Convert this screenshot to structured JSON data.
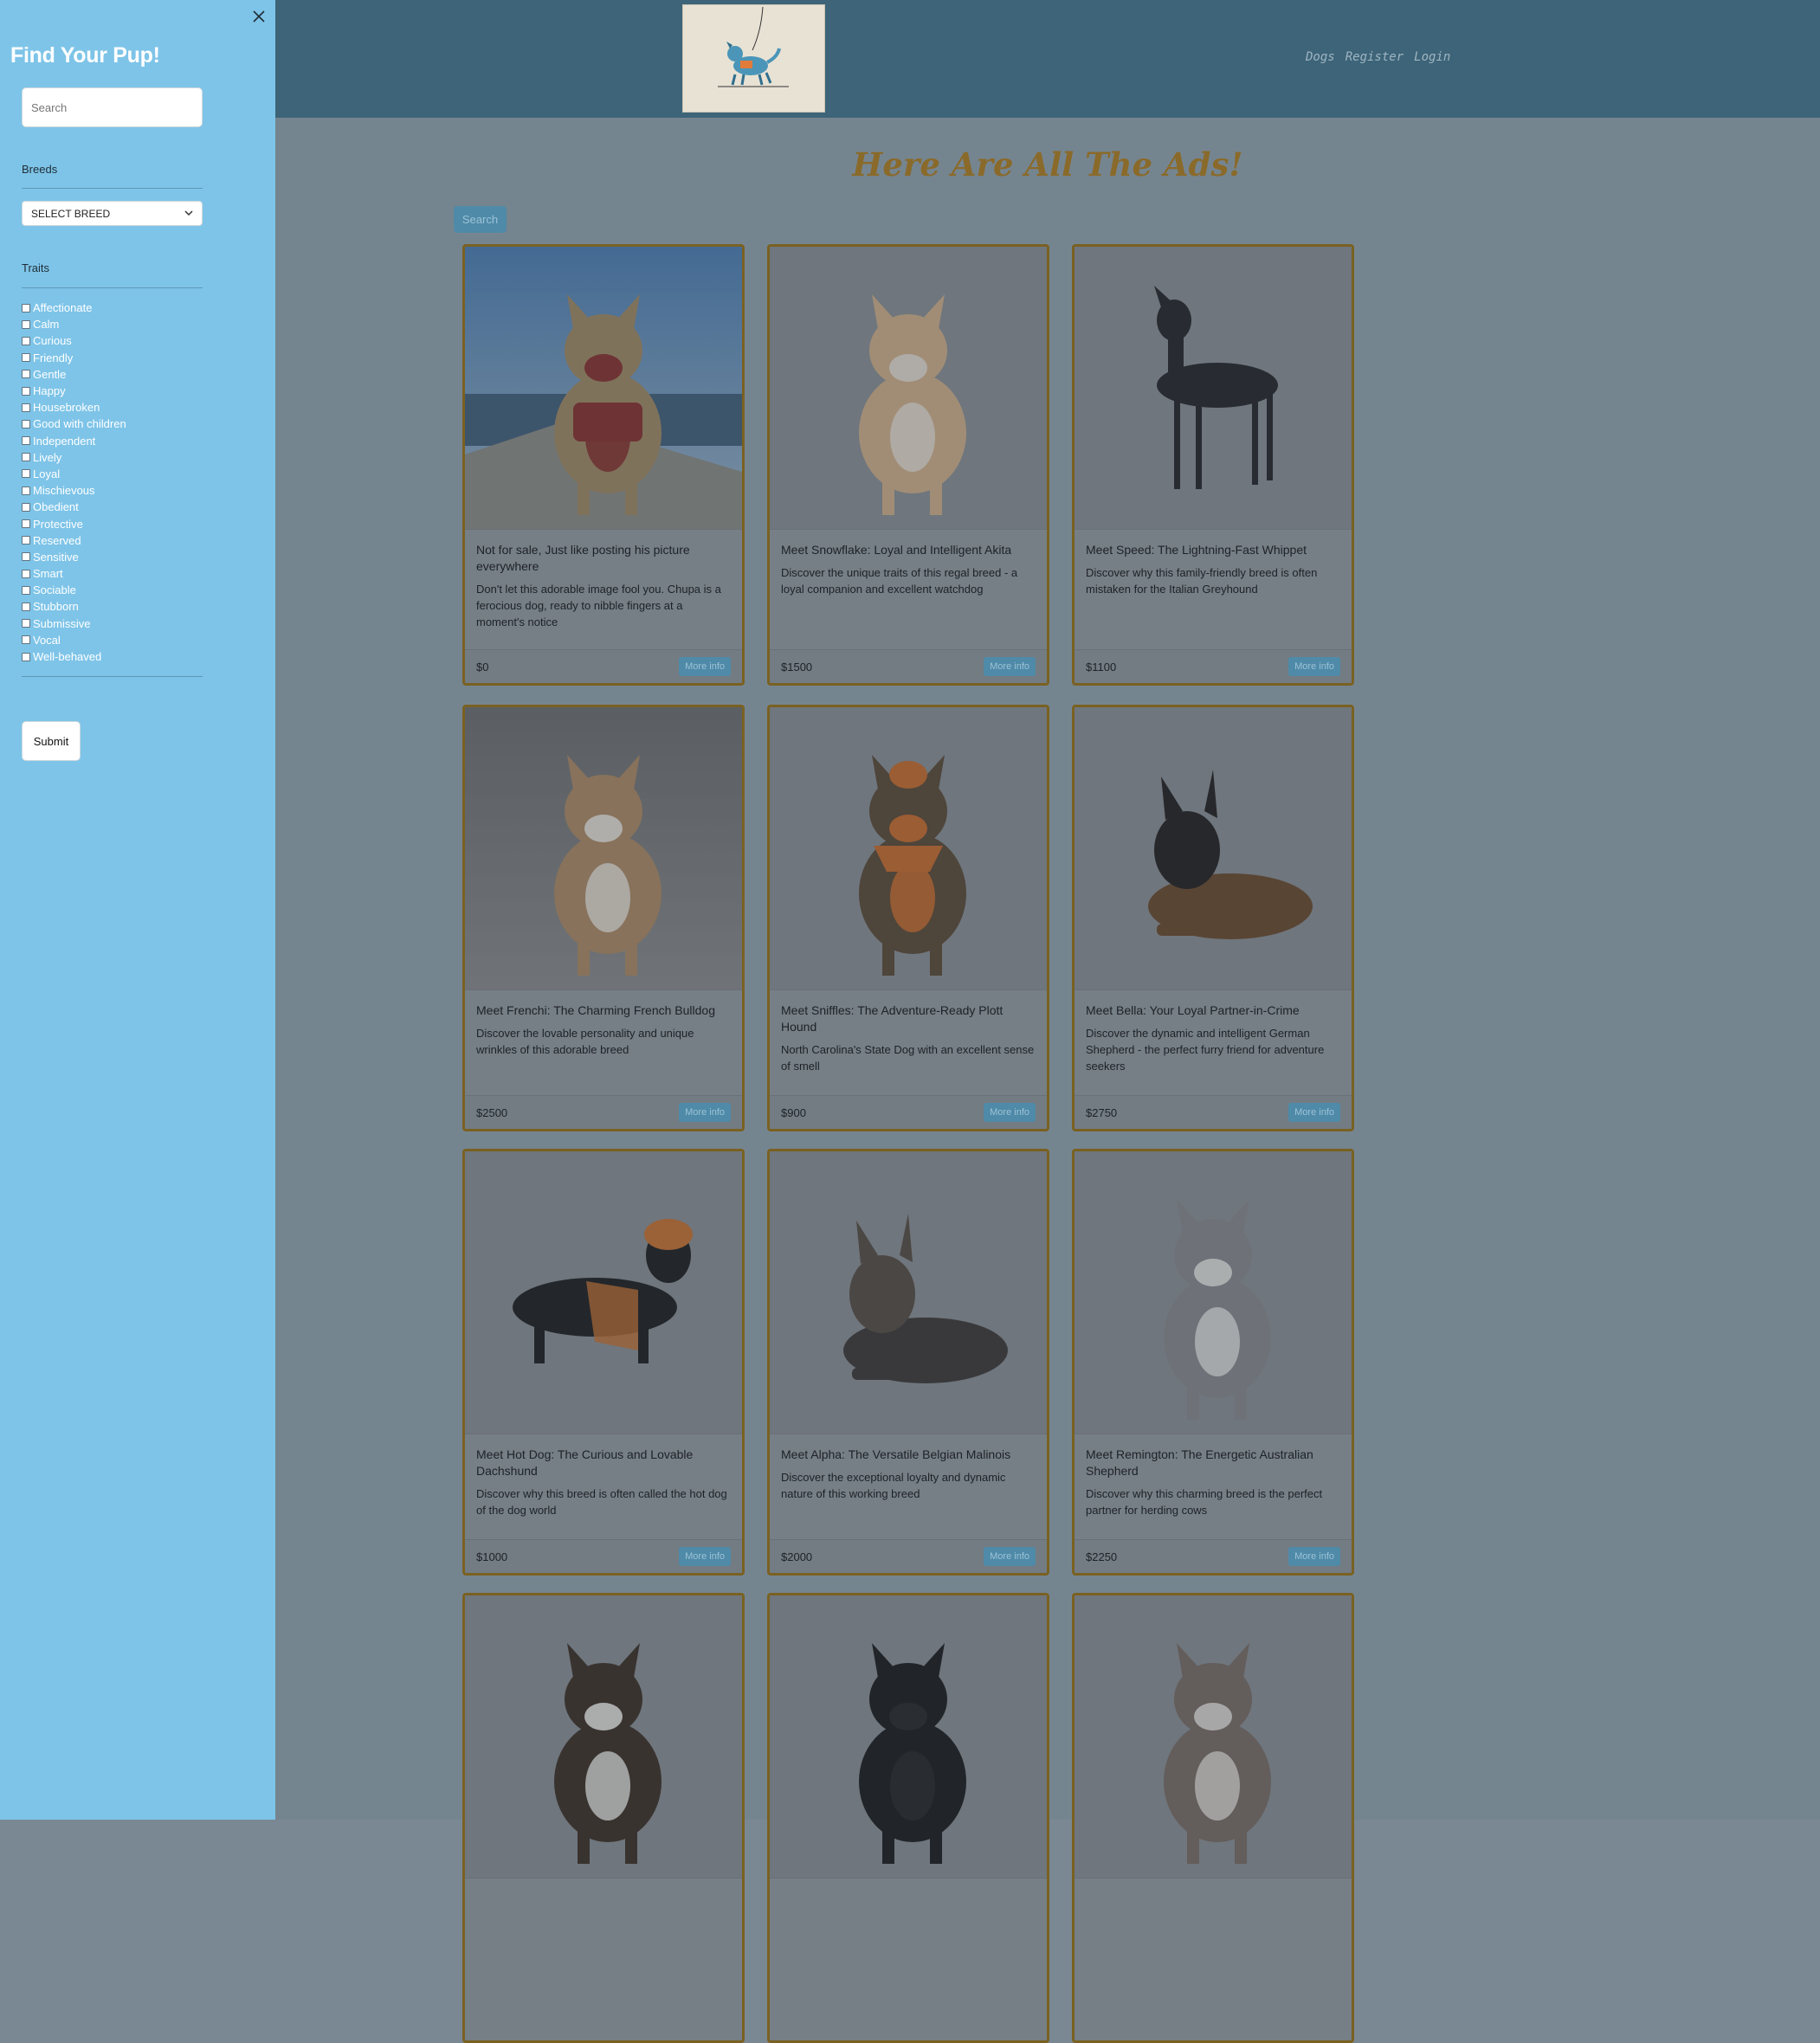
{
  "navbar": {
    "nav_links": [
      "Dogs",
      "Register",
      "Login"
    ]
  },
  "main": {
    "title": "Here Are All The Ads!",
    "search_button": "Search",
    "more_info_label": "More info"
  },
  "ads": [
    {
      "title": "Not for sale, Just like posting his picture everywhere",
      "text": "Don't let this adorable image fool you. Chupa is a ferocious dog, ready to nibble fingers at a moment's notice",
      "price": "$0",
      "image": "french-bulldog-on-dock-photo"
    },
    {
      "title": "Meet Snowflake: Loyal and Intelligent Akita",
      "text": "Discover the unique traits of this regal breed - a loyal companion and excellent watchdog",
      "price": "$1500",
      "image": "akita-photo"
    },
    {
      "title": "Meet Speed: The Lightning-Fast Whippet",
      "text": "Discover why this family-friendly breed is often mistaken for the Italian Greyhound",
      "price": "$1100",
      "image": "whippet-photo"
    },
    {
      "title": "Meet Frenchi: The Charming French Bulldog",
      "text": "Discover the lovable personality and unique wrinkles of this adorable breed",
      "price": "$2500",
      "image": "french-bulldog-photo"
    },
    {
      "title": "Meet Sniffles: The Adventure-Ready Plott Hound",
      "text": "North Carolina's State Dog with an excellent sense of smell",
      "price": "$900",
      "image": "plott-hound-photo"
    },
    {
      "title": "Meet Bella: Your Loyal Partner-in-Crime",
      "text": "Discover the dynamic and intelligent German Shepherd - the perfect furry friend for adventure seekers",
      "price": "$2750",
      "image": "german-shepherd-photo"
    },
    {
      "title": "Meet Hot Dog: The Curious and Lovable Dachshund",
      "text": "Discover why this breed is often called the hot dog of the dog world",
      "price": "$1000",
      "image": "dachshund-photo"
    },
    {
      "title": "Meet Alpha: The Versatile Belgian Malinois",
      "text": "Discover the exceptional loyalty and dynamic nature of this working breed",
      "price": "$2000",
      "image": "belgian-malinois-photo"
    },
    {
      "title": "Meet Remington: The Energetic Australian Shepherd",
      "text": "Discover why this charming breed is the perfect partner for herding cows",
      "price": "$2250",
      "image": "australian-shepherd-photo"
    },
    {
      "image": "basset-hound-photo"
    },
    {
      "image": "poodle-photo"
    },
    {
      "image": "bully-photo"
    }
  ],
  "offcanvas": {
    "title": "Find Your Pup!",
    "search_placeholder": "Search",
    "breeds_label": "Breeds",
    "breed_select_value": "SELECT BREED",
    "traits_label": "Traits",
    "traits": [
      "Affectionate",
      "Calm",
      "Curious",
      "Friendly",
      "Gentle",
      "Happy",
      "Housebroken",
      "Good with children",
      "Independent",
      "Lively",
      "Loyal",
      "Mischievous",
      "Obedient",
      "Protective",
      "Reserved",
      "Sensitive",
      "Smart",
      "Sociable",
      "Stubborn",
      "Submissive",
      "Vocal",
      "Well-behaved"
    ],
    "submit_label": "Submit"
  },
  "icons": {
    "close": "close-icon",
    "chevron": "chevron-down-icon"
  },
  "colors": {
    "sidebar_bg": "#7ec4e8",
    "navbar_bg": "#3d6478",
    "content_bg": "#758590",
    "card_border": "#7a6122",
    "title_color": "#8a6a2a",
    "button_blue": "#4f8aa8"
  }
}
